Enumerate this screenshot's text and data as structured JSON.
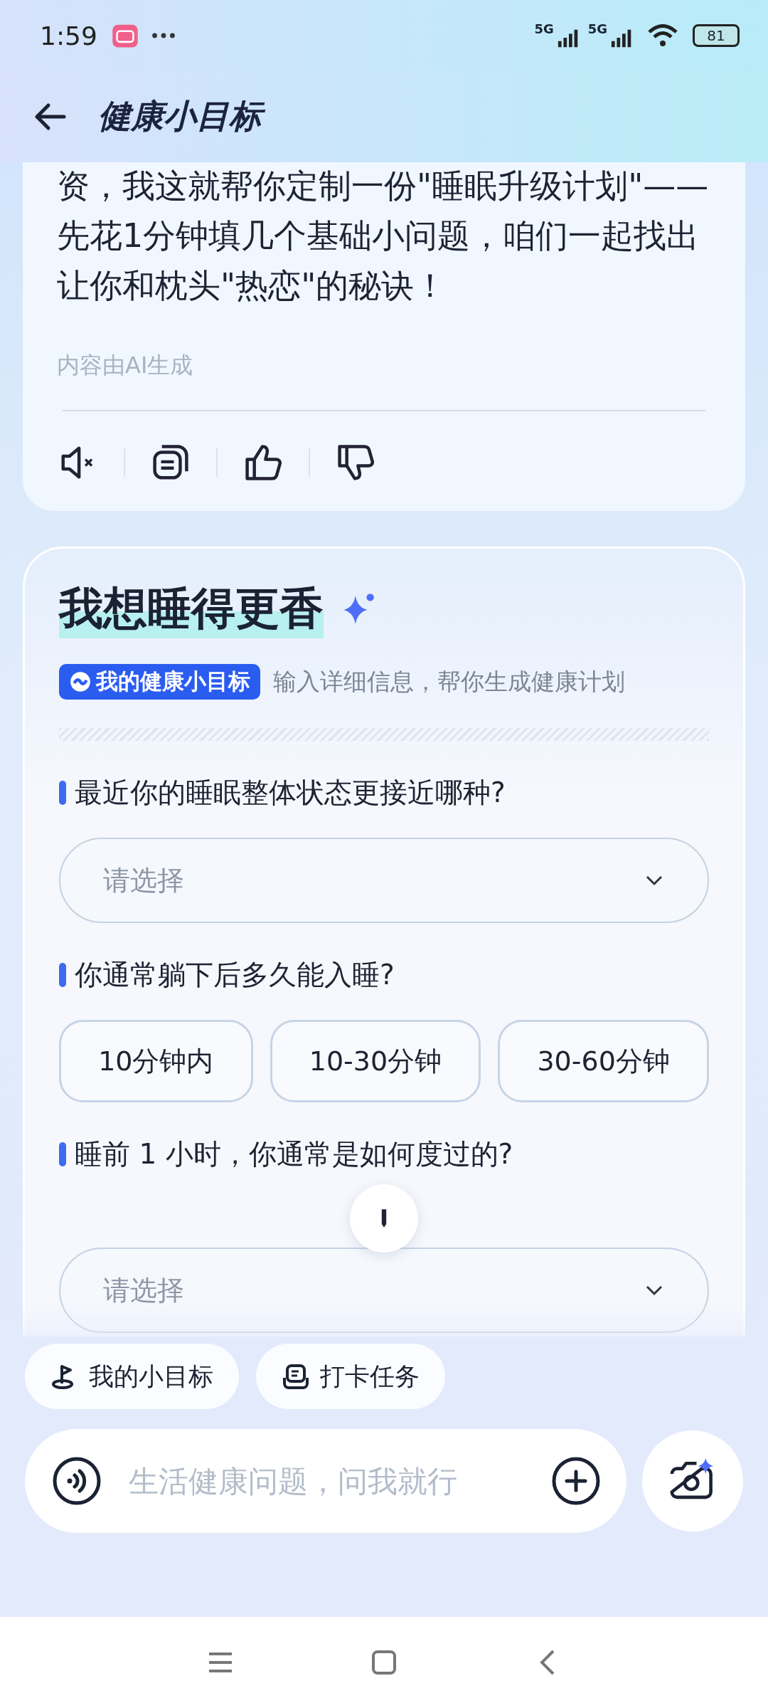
{
  "status_bar": {
    "time": "1:59",
    "signal_labels": [
      "5G",
      "5G"
    ],
    "battery": "81"
  },
  "header": {
    "title": "健康小目标"
  },
  "chat_message": {
    "text": "资，我这就帮你定制一份\"睡眠升级计划\"——先花1分钟填几个基础小问题，咱们一起找出让你和枕头\"热恋\"的秘诀！",
    "ai_notice": "内容由AI生成"
  },
  "form": {
    "title": "我想睡得更香",
    "badge": "我的健康小目标",
    "subtitle": "输入详细信息，帮你生成健康计划",
    "questions": [
      {
        "kind": "select",
        "label": "最近你的睡眠整体状态更接近哪种?",
        "placeholder": "请选择"
      },
      {
        "kind": "choices",
        "label": "你通常躺下后多久能入睡?",
        "options": [
          {
            "label": "10分钟内",
            "selected": false
          },
          {
            "label": "10-30分钟",
            "selected": false
          },
          {
            "label": "30-60分钟",
            "selected": false
          }
        ]
      },
      {
        "kind": "select",
        "label": "睡前 1 小时，你通常是如何度过的?",
        "placeholder": "请选择"
      }
    ]
  },
  "chips": [
    "我的小目标",
    "打卡任务"
  ],
  "input": {
    "placeholder": "生活健康问题，问我就行"
  }
}
